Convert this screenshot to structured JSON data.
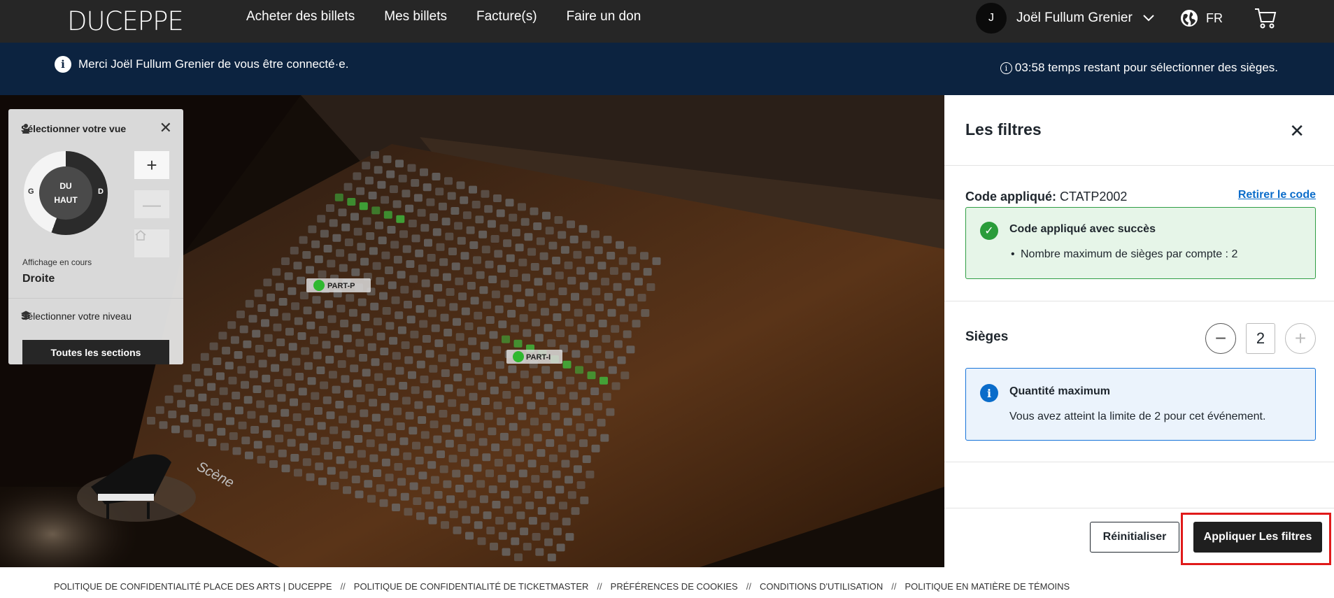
{
  "brand": "DUCEPPE",
  "nav": {
    "links": [
      "Acheter des billets",
      "Mes billets",
      "Facture(s)",
      "Faire un don"
    ],
    "user_initial": "J",
    "user_name": "Joël Fullum Grenier",
    "language": "FR",
    "icons": [
      "chevron-down-icon",
      "globe-icon",
      "cart-icon"
    ]
  },
  "infobar": {
    "message": "Merci Joël Fullum Grenier de vous être connecté·e.",
    "timer": "03:58 temps restant pour sélectionner des sièges."
  },
  "map": {
    "view_panel": {
      "title": "Sélectionner votre vue",
      "dial_center": "DU HAUT",
      "dial_left": "G",
      "dial_right": "D",
      "current_label": "Affichage en cours",
      "current_value": "Droite",
      "level_title": "Sélectionner votre niveau",
      "all_sections": "Toutes les sections"
    },
    "labels": {
      "stage": "Scène",
      "section_p": "PART-P",
      "section_i": "PART-I"
    },
    "colors": {
      "available_seat": "#3fbf3f",
      "seat": "#6b6b6b"
    }
  },
  "filters": {
    "title": "Les filtres",
    "code_label": "Code appliqué:",
    "code_value": "CTATP2002",
    "remove_code": "Retirer le code",
    "success_title": "Code appliqué avec succès",
    "success_item": "Nombre maximum de sièges par compte : 2",
    "seats_label": "Sièges",
    "seats_value": "2",
    "info_title": "Quantité maximum",
    "info_desc": "Vous avez atteint la limite de 2 pour cet événement.",
    "reset": "Réinitialiser",
    "apply": "Appliquer Les filtres"
  },
  "footer": {
    "links": [
      "POLITIQUE DE CONFIDENTIALITÉ PLACE DES ARTS | DUCEPPE",
      "POLITIQUE DE CONFIDENTIALITÉ DE TICKETMASTER",
      "PRÉFÉRENCES DE COOKIES",
      "CONDITIONS D'UTILISATION",
      "POLITIQUE EN MATIÈRE DE TÉMOINS"
    ],
    "separator": "//"
  }
}
